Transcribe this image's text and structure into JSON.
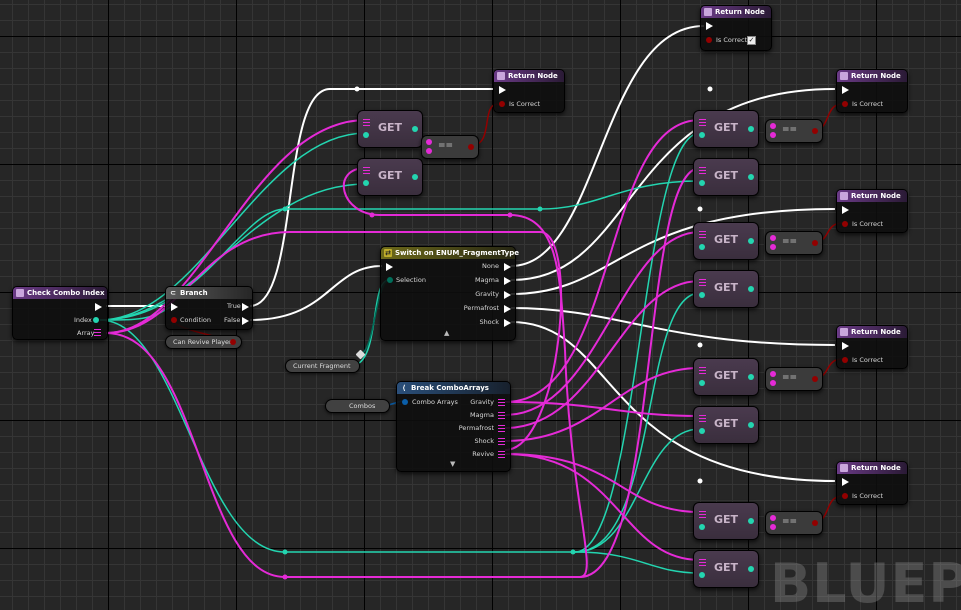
{
  "editor": {
    "watermark": "BLUEPF"
  },
  "nodes": {
    "check_combo_index": {
      "title": "Check Combo Index",
      "pins": [
        "Index",
        "Array"
      ]
    },
    "branch": {
      "title": "Branch",
      "pins": [
        "Condition",
        "True",
        "False"
      ]
    },
    "can_revive_player": {
      "label": "Can Revive Player"
    },
    "current_fragment": {
      "label": "Current Fragment"
    },
    "combos": {
      "label": "Combos"
    },
    "switch": {
      "title": "Switch on ENUM_FragmentType",
      "input": "Selection",
      "outputs": [
        "None",
        "Magma",
        "Gravity",
        "Permafrost",
        "Shock"
      ]
    },
    "break_combo_arrays": {
      "title": "Break ComboArrays",
      "input": "Combo Arrays",
      "outputs": [
        "Gravity",
        "Magma",
        "Permafrost",
        "Shock",
        "Revive"
      ]
    },
    "return_nodes": [
      {
        "title": "Return Node",
        "pin": "Is Correct",
        "checked": true
      },
      {
        "title": "Return Node",
        "pin": "Is Correct",
        "checked": false
      },
      {
        "title": "Return Node",
        "pin": "Is Correct",
        "checked": false
      },
      {
        "title": "Return Node",
        "pin": "Is Correct",
        "checked": false
      },
      {
        "title": "Return Node",
        "pin": "Is Correct",
        "checked": false
      },
      {
        "title": "Return Node",
        "pin": "Is Correct",
        "checked": false
      }
    ],
    "get_label": "GET",
    "equals_label": "=="
  },
  "colors": {
    "exec": "#ffffff",
    "int": "#23d5b0",
    "array": "#e52ad7",
    "bool": "#930000",
    "enum": "#006e5a",
    "struct": "#0a5ea9"
  }
}
